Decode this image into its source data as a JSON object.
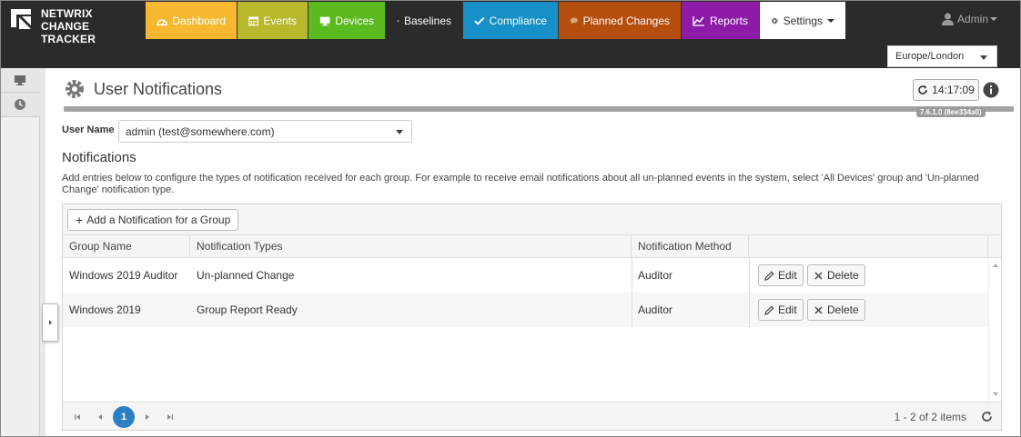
{
  "brand": {
    "line1": "NETWRIX",
    "line2": "CHANGE TRACKER"
  },
  "nav": [
    {
      "label": "Dashboard",
      "icon": "dashboard-icon",
      "color": "#f5b82e"
    },
    {
      "label": "Events",
      "icon": "calendar-icon",
      "color": "#b7b82c"
    },
    {
      "label": "Devices",
      "icon": "monitor-icon",
      "color": "#5bba1f"
    },
    {
      "label": "Baselines",
      "icon": "anchor-icon",
      "color": "#2b2b2b"
    },
    {
      "label": "Compliance",
      "icon": "check-icon",
      "color": "#178fc7"
    },
    {
      "label": "Planned Changes",
      "icon": "comment-icon",
      "color": "#b54e0d"
    },
    {
      "label": "Reports",
      "icon": "chart-icon",
      "color": "#8d1ba8"
    },
    {
      "label": "Settings",
      "icon": "gear-icon",
      "color": "#ffffff"
    }
  ],
  "user_menu": {
    "label": "Admin"
  },
  "timezone": {
    "value": "Europe/London"
  },
  "page": {
    "title": "User Notifications",
    "time": "14:17:09",
    "version": "7.6.1.0 (8ee334a0)"
  },
  "user_name": {
    "label": "User Name",
    "value": "admin (test@somewhere.com)"
  },
  "notifications": {
    "title": "Notifications",
    "description": "Add entries below to configure the types of notification received for each group. For example to receive email notifications about all un-planned events in the system, select 'All Devices' group and 'Un-planned Change' notification type.",
    "add_label": "Add a Notification for a Group"
  },
  "grid": {
    "columns": [
      "Group Name",
      "Notification Types",
      "Notification Method",
      ""
    ],
    "rows": [
      {
        "group": "Windows 2019 Auditor",
        "type": "Un-planned Change",
        "method": "Auditor"
      },
      {
        "group": "Windows 2019",
        "type": "Group Report Ready",
        "method": "Auditor"
      }
    ],
    "edit_label": "Edit",
    "delete_label": "Delete"
  },
  "pager": {
    "current_page": "1",
    "items_text": "1 - 2 of 2 items"
  }
}
